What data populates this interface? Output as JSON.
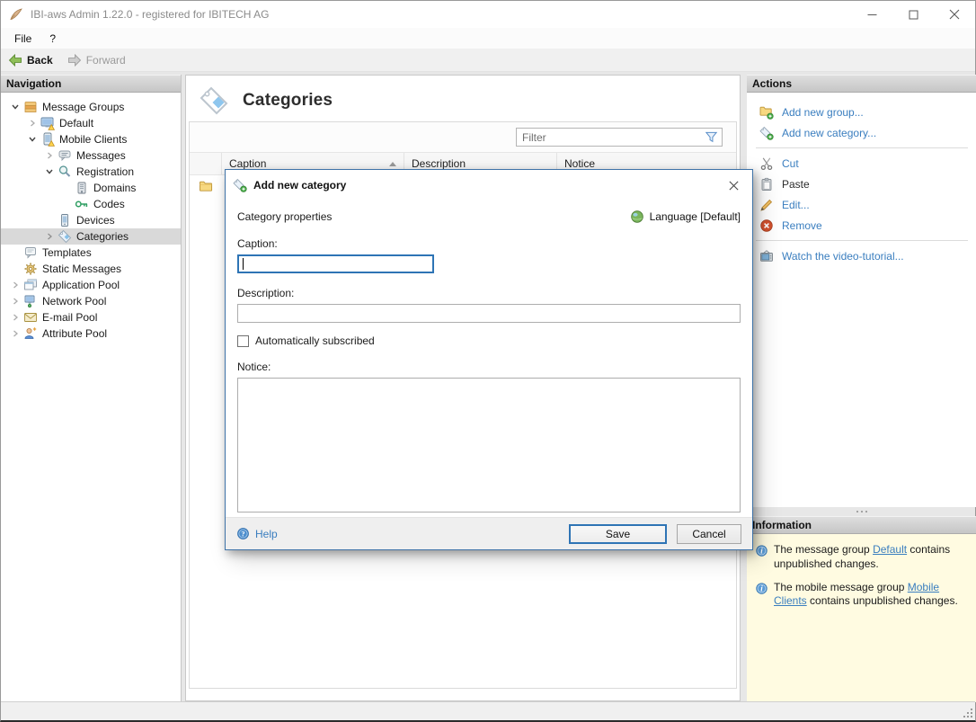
{
  "window": {
    "title": "IBI-aws Admin 1.22.0 - registered for IBITECH AG",
    "menu": {
      "file": "File",
      "help": "?"
    },
    "toolbar": {
      "back": "Back",
      "forward": "Forward"
    }
  },
  "nav": {
    "header": "Navigation",
    "tree": [
      {
        "label": "Message Groups",
        "level": 0,
        "state": "expanded"
      },
      {
        "label": "Default",
        "level": 1,
        "state": "collapsed"
      },
      {
        "label": "Mobile Clients",
        "level": 1,
        "state": "expanded"
      },
      {
        "label": "Messages",
        "level": 2,
        "state": "collapsed"
      },
      {
        "label": "Registration",
        "level": 2,
        "state": "expanded"
      },
      {
        "label": "Domains",
        "level": 3,
        "state": "leaf"
      },
      {
        "label": "Codes",
        "level": 3,
        "state": "leaf"
      },
      {
        "label": "Devices",
        "level": 2,
        "state": "leaf"
      },
      {
        "label": "Categories",
        "level": 2,
        "state": "collapsed",
        "selected": true
      },
      {
        "label": "Templates",
        "level": 0,
        "state": "leaf"
      },
      {
        "label": "Static Messages",
        "level": 0,
        "state": "leaf"
      },
      {
        "label": "Application Pool",
        "level": 0,
        "state": "collapsed"
      },
      {
        "label": "Network Pool",
        "level": 0,
        "state": "collapsed"
      },
      {
        "label": "E-mail Pool",
        "level": 0,
        "state": "collapsed"
      },
      {
        "label": "Attribute Pool",
        "level": 0,
        "state": "collapsed"
      }
    ]
  },
  "main": {
    "title": "Categories",
    "filter_placeholder": "Filter",
    "columns": [
      "Caption",
      "Description",
      "Notice"
    ],
    "sort": {
      "column": "Caption",
      "direction": "ascending"
    }
  },
  "actions": {
    "header": "Actions",
    "items": [
      {
        "label": "Add new group...",
        "enabled": true
      },
      {
        "label": "Add new category...",
        "enabled": true
      },
      {
        "label": "Cut",
        "enabled": true
      },
      {
        "label": "Paste",
        "enabled": false
      },
      {
        "label": "Edit...",
        "enabled": true
      },
      {
        "label": "Remove",
        "enabled": true
      },
      {
        "label": "Watch the video-tutorial...",
        "enabled": true
      }
    ]
  },
  "information": {
    "header": "Information",
    "items": [
      {
        "prefix": "The message group ",
        "link": "Default",
        "suffix": " contains unpublished changes."
      },
      {
        "prefix": "The mobile message group ",
        "link": "Mobile Clients",
        "suffix": " contains unpublished changes."
      }
    ]
  },
  "dialog": {
    "title": "Add new category",
    "section_label": "Category properties",
    "language_label": "Language [Default]",
    "caption_label": "Caption:",
    "caption_value": "",
    "description_label": "Description:",
    "description_value": "",
    "auto_subscribed_label": "Automatically subscribed",
    "auto_subscribed_checked": false,
    "notice_label": "Notice:",
    "notice_value": "",
    "help_label": "Help",
    "save_label": "Save",
    "cancel_label": "Cancel"
  },
  "colors": {
    "accent_blue": "#2e74b5",
    "link_blue": "#3a7ebf",
    "info_panel_bg": "#fffbe1",
    "selected_row_bg": "#d9d9d9",
    "panel_header_bg": "#cfcfcf"
  }
}
